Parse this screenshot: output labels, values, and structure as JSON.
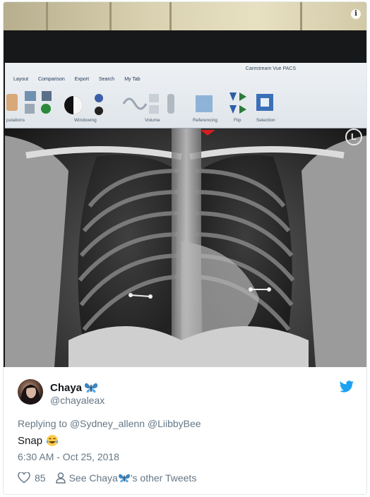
{
  "photo": {
    "app_title": "Carestream Vue PACS",
    "menu": [
      "Layout",
      "Comparison",
      "Export",
      "Search",
      "My Tab"
    ],
    "group_labels": [
      "pulations",
      "Windowing",
      "Volume",
      "Referencing",
      "Flip",
      "Selection"
    ],
    "orientation_marker": "L",
    "info_icon": "i"
  },
  "tweet": {
    "name": "Chaya",
    "name_emoji": "butterfly-emoji",
    "handle": "@chayaleax",
    "reply_prefix": "Replying to",
    "reply_to": [
      "@Sydney_allenn",
      "@LiibbyBee"
    ],
    "text": "Snap",
    "text_emoji": "face-with-tears-of-joy-emoji",
    "timestamp": "6:30 AM - Oct 25, 2018",
    "likes": "85",
    "profile_link_prefix": "See Chaya",
    "profile_link_suffix": "'s other Tweets",
    "brand_icon": "twitter-bird-icon",
    "colors": {
      "brand": "#1da1f2",
      "muted": "#657786",
      "text": "#14171a"
    }
  }
}
